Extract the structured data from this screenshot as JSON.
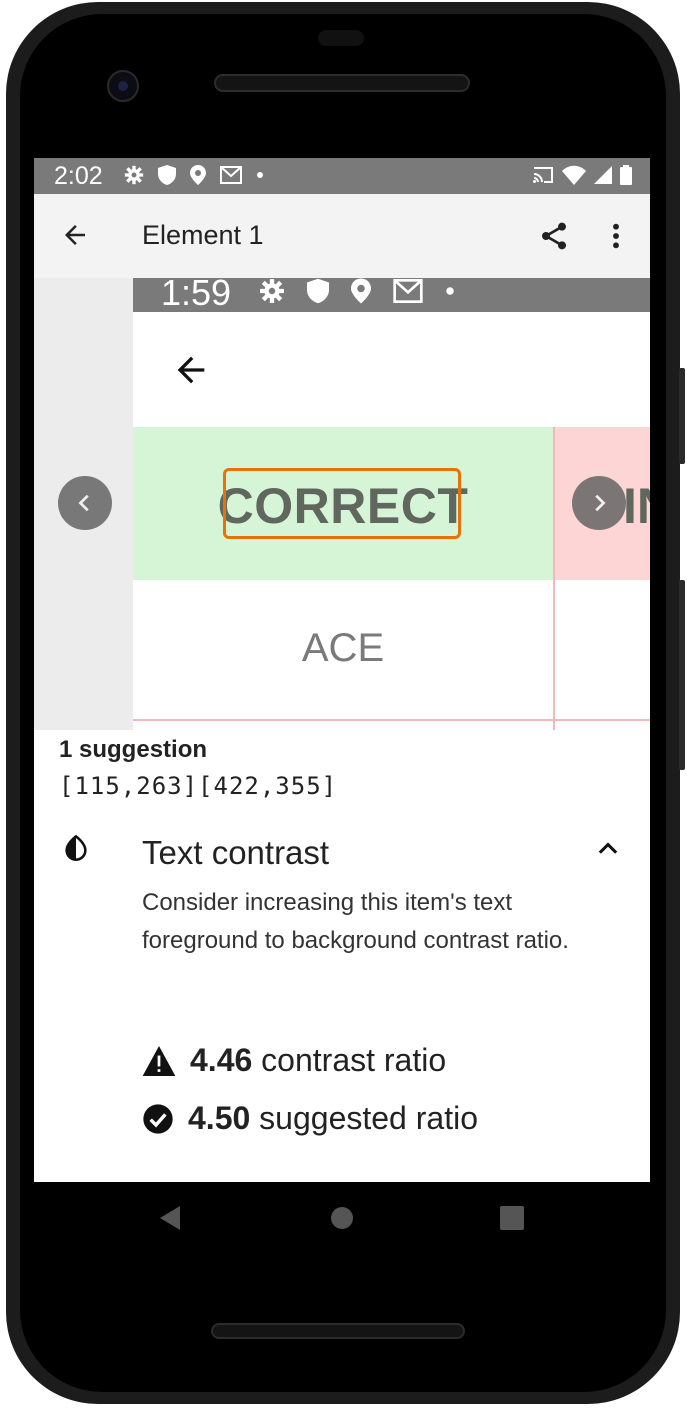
{
  "status_bar": {
    "time": "2:02"
  },
  "app_bar": {
    "title": "Element 1"
  },
  "preview": {
    "status_time": "1:59",
    "correct_text": "CORRECT",
    "incorrect_text": "IN",
    "ace_text": "ACE"
  },
  "suggestions": {
    "count_label": "1 suggestion",
    "bounds": "[115,263][422,355]",
    "items": [
      {
        "title": "Text contrast",
        "description": "Consider increasing this item's text foreground to background contrast ratio.",
        "current_ratio": "4.46",
        "current_label": " contrast ratio",
        "suggested_ratio": "4.50",
        "suggested_label": " suggested ratio"
      }
    ]
  },
  "colors": {
    "highlight": "#e8710a",
    "correct_bg": "#d6f5d6",
    "incorrect_bg": "#fdd5d5",
    "status_bar": "#7a7a7a"
  }
}
